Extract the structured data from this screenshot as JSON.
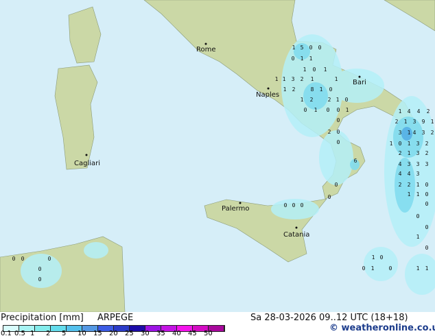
{
  "map": {
    "colors": {
      "sea": "#d6eef8",
      "land": "#cbd8a6",
      "precip_light": "#b4f0f8",
      "precip_mid": "#82dcee",
      "precip_strong": "#5ab4e6"
    },
    "cities": [
      "Rome",
      "Naples",
      "Bari",
      "Cagliari",
      "Palermo",
      "Catania"
    ],
    "precip_values": [
      "1",
      "5",
      "0",
      "0",
      "0",
      "1",
      "1",
      "1",
      "0",
      "1",
      "1",
      "1",
      "3",
      "2",
      "1",
      "1",
      "1",
      "2",
      "8",
      "1",
      "0",
      "1",
      "2",
      "2",
      "1",
      "0",
      "0",
      "1",
      "0",
      "0",
      "1",
      "0",
      "2",
      "0",
      "0",
      "1",
      "4",
      "4",
      "2",
      "2",
      "1",
      "3",
      "9",
      "1",
      "3",
      "1",
      "4",
      "3",
      "2",
      "1",
      "0",
      "1",
      "3",
      "2",
      "2",
      "1",
      "3",
      "2",
      "4",
      "3",
      "3",
      "3",
      "4",
      "4",
      "3",
      "0",
      "2",
      "2",
      "1",
      "0",
      "1",
      "1",
      "0",
      "0",
      "0",
      "1",
      "0",
      "1",
      "0",
      "0",
      "1",
      "0",
      "1",
      "1",
      "6",
      "0",
      "0",
      "0",
      "0",
      "0",
      "0",
      "0",
      "0",
      "0",
      "0"
    ]
  },
  "legend": {
    "title": "Precipitation [mm]",
    "model": "ARPEGE",
    "ticks": [
      "0.1",
      "0.5",
      "1",
      "2",
      "5",
      "10",
      "15",
      "20",
      "25",
      "30",
      "35",
      "40",
      "45",
      "50"
    ],
    "colors": [
      "#d8fcfc",
      "#a8f4f4",
      "#84ecec",
      "#64dcec",
      "#54c0ec",
      "#5498e4",
      "#3c5ce4",
      "#2c3cc8",
      "#1c0ca8",
      "#9c14e4",
      "#c414e4",
      "#f414ec",
      "#d40cc4",
      "#a8089c"
    ]
  },
  "datetime": "Sa 28-03-2026 09..12 UTC (18+18)",
  "credit": "© weatheronline.co.uk"
}
